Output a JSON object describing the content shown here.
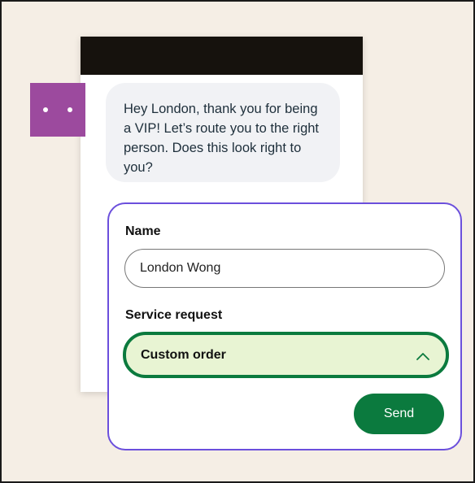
{
  "chat": {
    "message": "Hey London, thank you for being a VIP! Let’s route you to the right person. Does this look right to you?"
  },
  "form": {
    "name_label": "Name",
    "name_value": "London Wong",
    "service_label": "Service request",
    "service_value": "Custom order",
    "send_label": "Send"
  },
  "colors": {
    "background": "#f5eee5",
    "header": "#16120d",
    "avatar": "#9c4a9e",
    "accent_purple": "#6b4fdc",
    "primary_green": "#0b7a3e",
    "select_fill": "#e8f4d3"
  },
  "icons": {
    "avatar": "ellipsis-dots-icon",
    "select": "chevron-up-icon"
  }
}
